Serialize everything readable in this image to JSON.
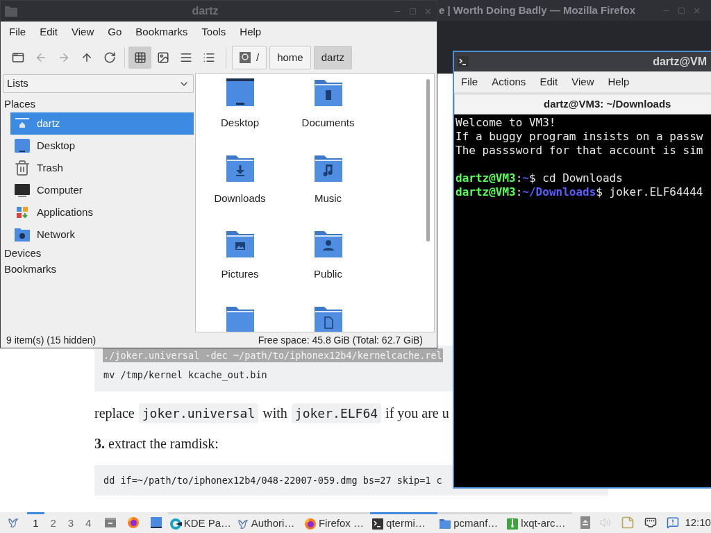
{
  "firefox": {
    "title": "e | Worth Doing Badly — Mozilla Firefox",
    "page": {
      "code_block_1": [
        {
          "text": "./joker.universal -dec ~/path/to/iphonex12b4/kernelcache.rel",
          "selected": true
        },
        {
          "text": "mv /tmp/kernel kcache_out.bin",
          "selected": false
        }
      ],
      "paragraph": [
        {
          "kind": "text",
          "text": "replace"
        },
        {
          "kind": "code",
          "text": "joker.universal"
        },
        {
          "kind": "text",
          "text": "with"
        },
        {
          "kind": "code",
          "text": "joker.ELF64"
        },
        {
          "kind": "text",
          "text": "if you are u"
        }
      ],
      "step": {
        "number": "3.",
        "text": "extract the ramdisk:"
      },
      "code_block_2": [
        {
          "text": "dd if=~/path/to/iphonex12b4/048-22007-059.dmg bs=27 skip=1 c",
          "selected": false
        }
      ]
    }
  },
  "file_manager": {
    "title": "dartz",
    "menu": [
      "File",
      "Edit",
      "View",
      "Go",
      "Bookmarks",
      "Tools",
      "Help"
    ],
    "nav_buttons": [
      {
        "kind": "new-window",
        "disabled": false
      },
      {
        "kind": "back",
        "disabled": true
      },
      {
        "kind": "forward",
        "disabled": true
      },
      {
        "kind": "up",
        "disabled": false
      },
      {
        "kind": "reload",
        "disabled": false
      }
    ],
    "view_modes": [
      {
        "kind": "icons",
        "selected": true
      },
      {
        "kind": "thumbnails",
        "selected": false
      },
      {
        "kind": "compact",
        "selected": false
      },
      {
        "kind": "detailed",
        "selected": false
      }
    ],
    "path": [
      {
        "label": "/",
        "selected": false
      },
      {
        "label": "home",
        "selected": false
      },
      {
        "label": "dartz",
        "selected": true
      }
    ],
    "sidebar": {
      "dropdown": "Lists",
      "sections": [
        {
          "title": "Places",
          "items": [
            {
              "label": "dartz",
              "kind": "home",
              "selected": true
            },
            {
              "label": "Desktop",
              "kind": "desktop",
              "selected": false
            },
            {
              "label": "Trash",
              "kind": "trash",
              "selected": false
            },
            {
              "label": "Computer",
              "kind": "computer",
              "selected": false
            },
            {
              "label": "Applications",
              "kind": "applications",
              "selected": false
            },
            {
              "label": "Network",
              "kind": "network",
              "selected": false
            }
          ]
        },
        {
          "title": "Devices"
        },
        {
          "title": "Bookmarks"
        }
      ]
    },
    "files": [
      {
        "name": "Desktop",
        "kind": "desktop"
      },
      {
        "name": "Documents",
        "kind": "documents"
      },
      {
        "name": "Downloads",
        "kind": "downloads"
      },
      {
        "name": "Music",
        "kind": "music"
      },
      {
        "name": "Pictures",
        "kind": "pictures"
      },
      {
        "name": "Public",
        "kind": "public"
      },
      {
        "kind": "folder"
      },
      {
        "kind": "templates"
      }
    ],
    "status_bar": {
      "items": "9 item(s) (15 hidden)",
      "free_space": "Free space: 45.8 GiB (Total: 62.7 GiB)"
    }
  },
  "terminal": {
    "title": "dartz@VM",
    "menu": [
      "File",
      "Actions",
      "Edit",
      "View",
      "Help"
    ],
    "tab": "dartz@VM3: ~/Downloads",
    "lines": [
      {
        "kind": "text",
        "segments": [
          {
            "text": "Welcome to VM3!",
            "color": "#e8e8e8"
          }
        ]
      },
      {
        "kind": "text",
        "segments": [
          {
            "text": "If a buggy program insists on a passw",
            "color": "#e8e8e8"
          }
        ]
      },
      {
        "kind": "text",
        "segments": [
          {
            "text": "The passsword for that account is sim",
            "color": "#e8e8e8"
          }
        ]
      },
      {
        "kind": "blank"
      },
      {
        "kind": "text",
        "segments": [
          {
            "text": "dartz@VM3",
            "color": "#54ff54"
          },
          {
            "text": ":",
            "color": "#e8e8e8"
          },
          {
            "text": "~",
            "color": "#5c5cff"
          },
          {
            "text": "$ cd Downloads",
            "color": "#e8e8e8"
          }
        ]
      },
      {
        "kind": "text",
        "segments": [
          {
            "text": "dartz@VM3",
            "color": "#54ff54"
          },
          {
            "text": ":",
            "color": "#e8e8e8"
          },
          {
            "text": "~/Downloads",
            "color": "#5c5cff"
          },
          {
            "text": "$ joker.ELF64444",
            "color": "#e8e8e8"
          }
        ]
      }
    ]
  },
  "taskbar": {
    "workspaces": [
      {
        "label": "1",
        "selected": true
      },
      {
        "label": "2",
        "selected": false
      },
      {
        "label": "3",
        "selected": false
      },
      {
        "label": "4",
        "selected": false
      }
    ],
    "launchers": [
      {
        "kind": "file-cabinet"
      },
      {
        "kind": "firefox"
      },
      {
        "kind": "desktop"
      }
    ],
    "tasks": [
      {
        "label": "KDE Pa…",
        "kind": "kde",
        "selected": false
      },
      {
        "label": "Authori…",
        "kind": "bird",
        "selected": false
      },
      {
        "label": "Firefox …",
        "kind": "firefox",
        "selected": false
      },
      {
        "label": "qtermi…",
        "kind": "terminal",
        "selected": true
      },
      {
        "label": "pcmanf…",
        "kind": "folder",
        "selected": false
      },
      {
        "label": "lxqt-arc…",
        "kind": "archive",
        "selected": false
      }
    ],
    "clock": "12:10"
  }
}
